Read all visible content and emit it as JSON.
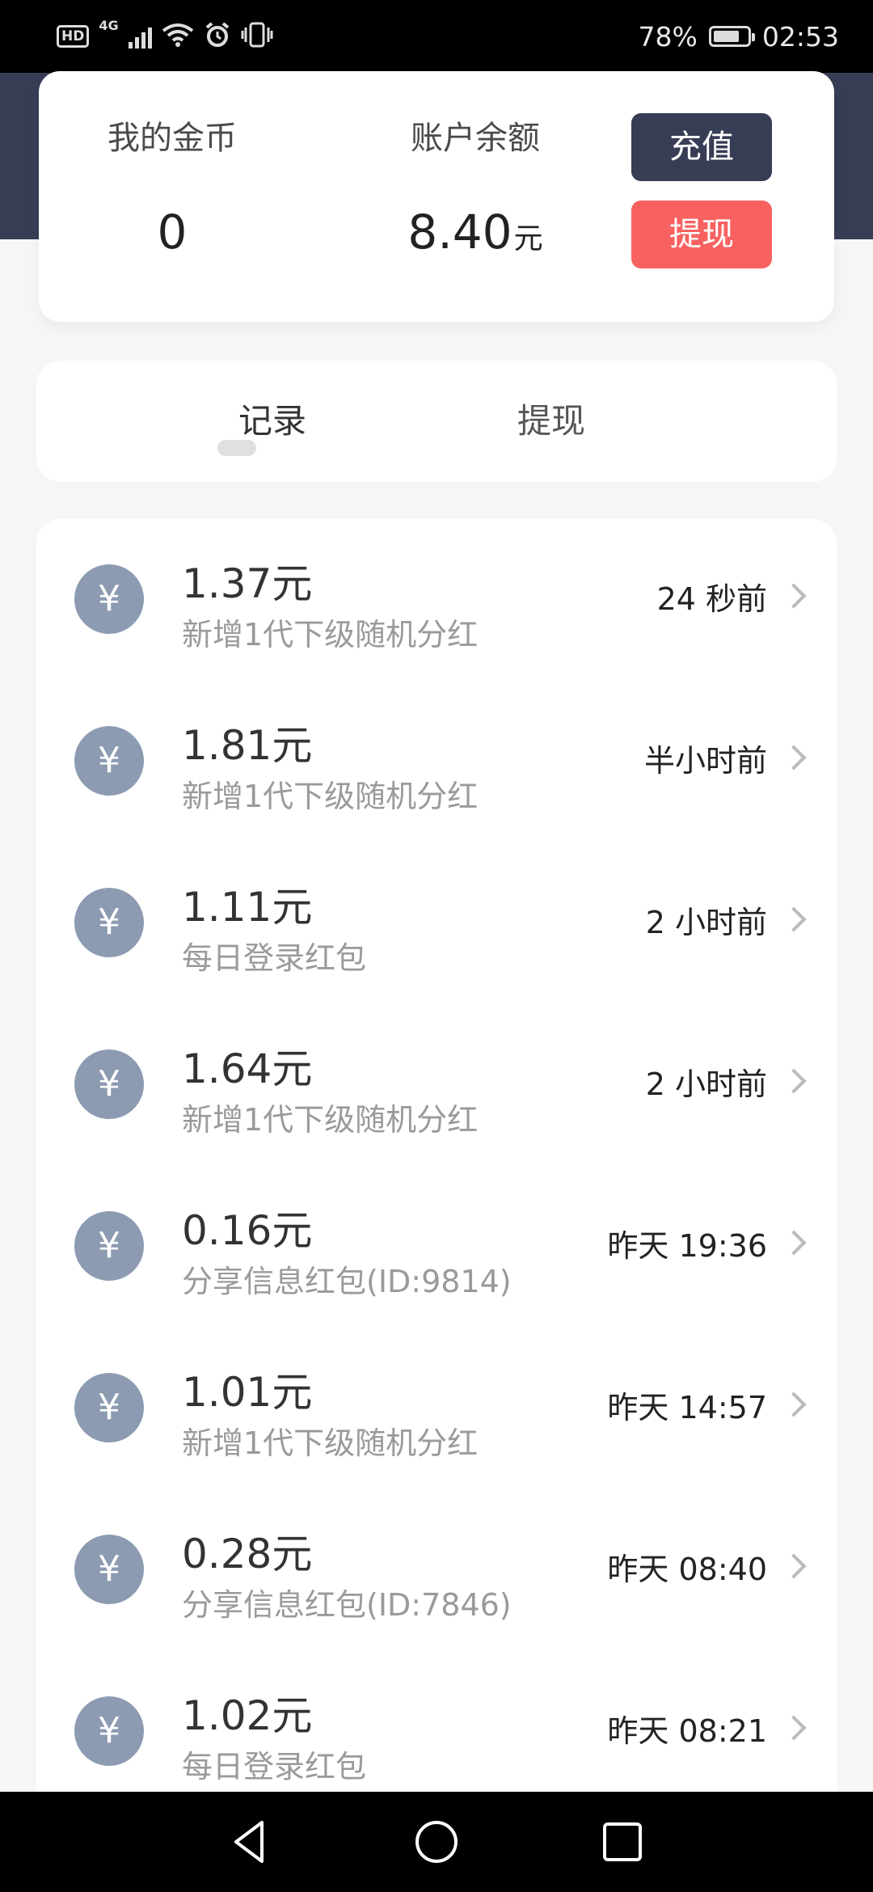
{
  "status_bar": {
    "hd_label": "HD",
    "network_label": "4G",
    "battery_percent": "78%",
    "battery_level": 0.78,
    "time": "02:53"
  },
  "balance": {
    "coins_label": "我的金币",
    "coins_value": "0",
    "account_label": "账户余额",
    "account_value": "8.40",
    "account_unit": "元",
    "recharge_button": "充值",
    "withdraw_button": "提现"
  },
  "tabs": [
    {
      "label": "记录",
      "active": true
    },
    {
      "label": "提现",
      "active": false
    }
  ],
  "records": [
    {
      "amount": "1.37元",
      "desc": "新增1代下级随机分红",
      "time": "24 秒前"
    },
    {
      "amount": "1.81元",
      "desc": "新增1代下级随机分红",
      "time": "半小时前"
    },
    {
      "amount": "1.11元",
      "desc": "每日登录红包",
      "time": "2 小时前"
    },
    {
      "amount": "1.64元",
      "desc": "新增1代下级随机分红",
      "time": "2 小时前"
    },
    {
      "amount": "0.16元",
      "desc": "分享信息红包(ID:9814)",
      "time": "昨天 19:36"
    },
    {
      "amount": "1.01元",
      "desc": "新增1代下级随机分红",
      "time": "昨天 14:57"
    },
    {
      "amount": "0.28元",
      "desc": "分享信息红包(ID:7846)",
      "time": "昨天 08:40"
    },
    {
      "amount": "1.02元",
      "desc": "每日登录红包",
      "time": "昨天 08:21"
    }
  ],
  "icons": {
    "coin": "yuan-coin-icon",
    "coin_glyph": "¥",
    "row_arrow": "chevron-right-icon"
  },
  "colors": {
    "header": "#373d54",
    "recharge": "#373d54",
    "withdraw": "#f76261",
    "coin": "#8c9bb1"
  }
}
